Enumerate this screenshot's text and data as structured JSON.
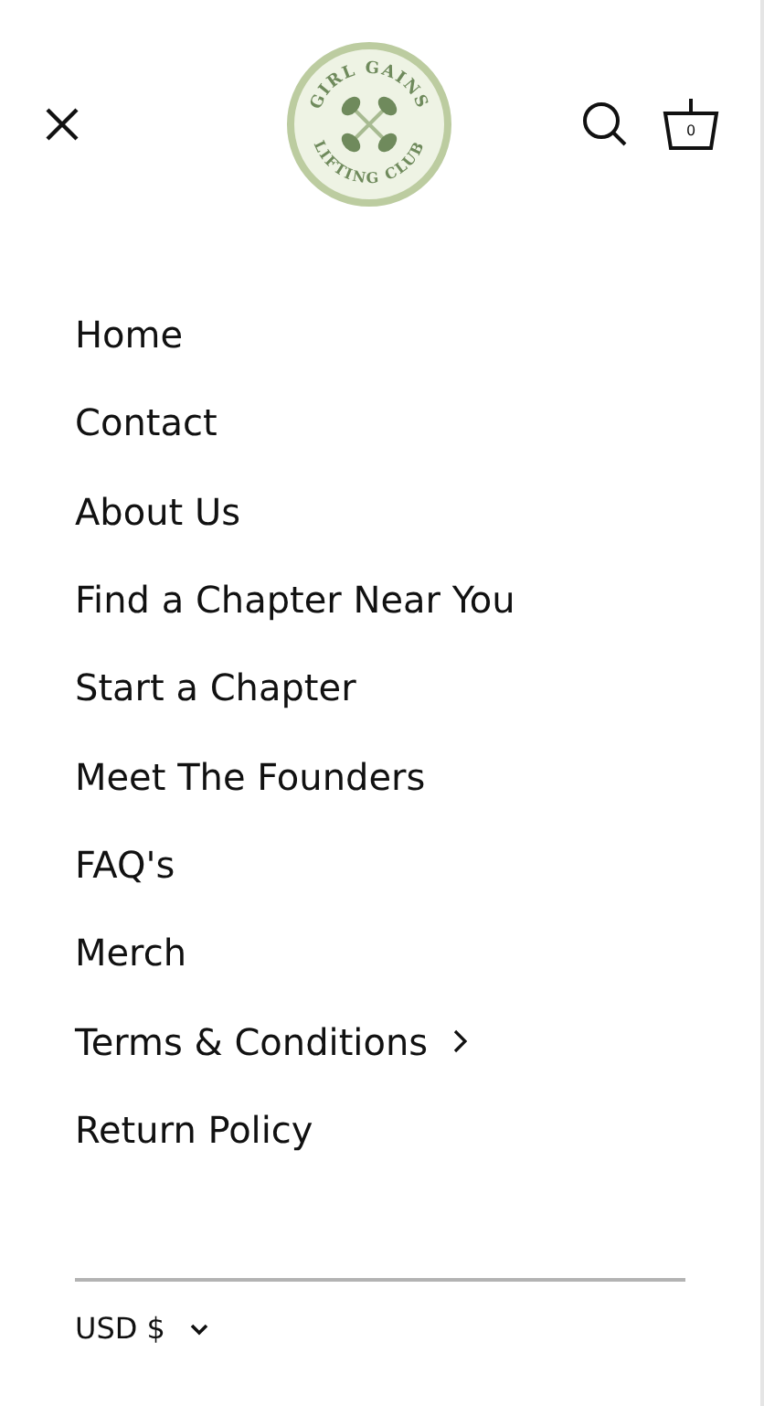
{
  "header": {
    "logo": {
      "top_text": "GIRL GAINS",
      "bottom_text": "LIFTING CLUB"
    },
    "cart_count": "0"
  },
  "menu": [
    {
      "label": "Home",
      "has_submenu": false
    },
    {
      "label": "Contact",
      "has_submenu": false
    },
    {
      "label": "About Us",
      "has_submenu": false
    },
    {
      "label": "Find a Chapter Near You",
      "has_submenu": false
    },
    {
      "label": "Start a Chapter",
      "has_submenu": false
    },
    {
      "label": "Meet The Founders",
      "has_submenu": false
    },
    {
      "label": "FAQ's",
      "has_submenu": false
    },
    {
      "label": "Merch",
      "has_submenu": false
    },
    {
      "label": "Terms & Conditions",
      "has_submenu": true
    },
    {
      "label": "Return Policy",
      "has_submenu": false
    }
  ],
  "currency": {
    "value": "USD $"
  }
}
